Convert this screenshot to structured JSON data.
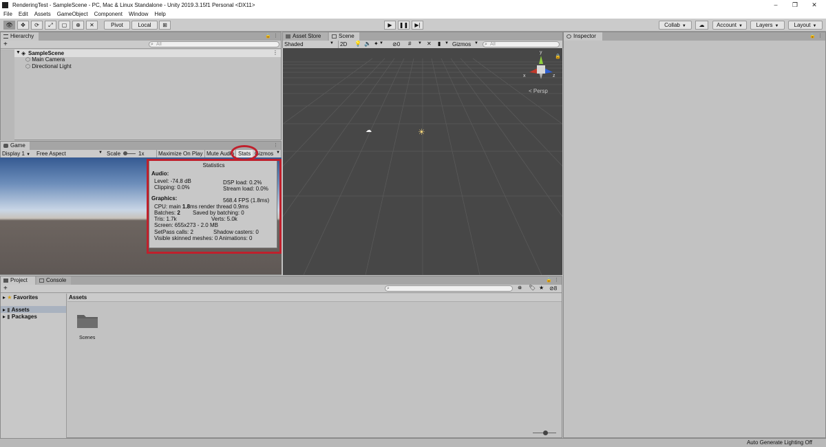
{
  "window": {
    "title": "RenderingTest - SampleScene - PC, Mac & Linux Standalone - Unity 2019.3.15f1 Personal <DX11>",
    "controls": [
      "–",
      "❐",
      "✕"
    ]
  },
  "menu": [
    "File",
    "Edit",
    "Assets",
    "GameObject",
    "Component",
    "Window",
    "Help"
  ],
  "toolbar": {
    "pivot": "Pivot",
    "local": "Local",
    "collab": "Collab",
    "account": "Account",
    "layers": "Layers",
    "layout": "Layout"
  },
  "hierarchy": {
    "tab": "Hierarchy",
    "add": "+",
    "search_placeholder": "All",
    "scene": "SampleScene",
    "items": [
      "Main Camera",
      "Directional Light"
    ]
  },
  "game": {
    "tab": "Game",
    "display": "Display 1",
    "aspect": "Free Aspect",
    "scale_label": "Scale",
    "scale_value": "1x",
    "maximize": "Maximize On Play",
    "mute": "Mute Audio",
    "stats": "Stats",
    "gizmos": "Gizmos"
  },
  "statistics": {
    "title": "Statistics",
    "audio_header": "Audio:",
    "level": "Level: -74.8 dB",
    "clipping": "Clipping: 0.0%",
    "dsp": "DSP load: 0.2%",
    "stream": "Stream load: 0.0%",
    "graphics_header": "Graphics:",
    "fps": "568.4 FPS (1.8ms)",
    "cpu_prefix": "CPU: main ",
    "cpu_main": "1.8",
    "cpu_suffix": "ms  render thread 0.9ms",
    "batches_prefix": "Batches: ",
    "batches": "2",
    "saved": "Saved by batching: 0",
    "tris": "Tris: 1.7k",
    "verts": "Verts: 5.0k",
    "screen": "Screen: 655x273 - 2.0 MB",
    "setpass": "SetPass calls: 2",
    "shadow": "Shadow casters: 0",
    "skinned": "Visible skinned meshes: 0",
    "animations": "Animations: 0"
  },
  "scene": {
    "asset_store_tab": "Asset Store",
    "tab": "Scene",
    "shading": "Shaded",
    "mode_2d": "2D",
    "hidden_count": "0",
    "gizmos": "Gizmos",
    "search_placeholder": "All",
    "persp": "Persp",
    "axis_x": "x",
    "axis_y": "y",
    "axis_z": "z"
  },
  "inspector": {
    "tab": "Inspector"
  },
  "project": {
    "project_tab": "Project",
    "console_tab": "Console",
    "add": "+",
    "favorites": "Favorites",
    "assets": "Assets",
    "packages": "Packages",
    "breadcrumb": "Assets",
    "folder": "Scenes",
    "hidden_count": "8"
  },
  "status": {
    "lighting": "Auto Generate Lighting Off"
  },
  "colors": {
    "highlight": "#c0202c",
    "scene_bg": "#474747"
  }
}
